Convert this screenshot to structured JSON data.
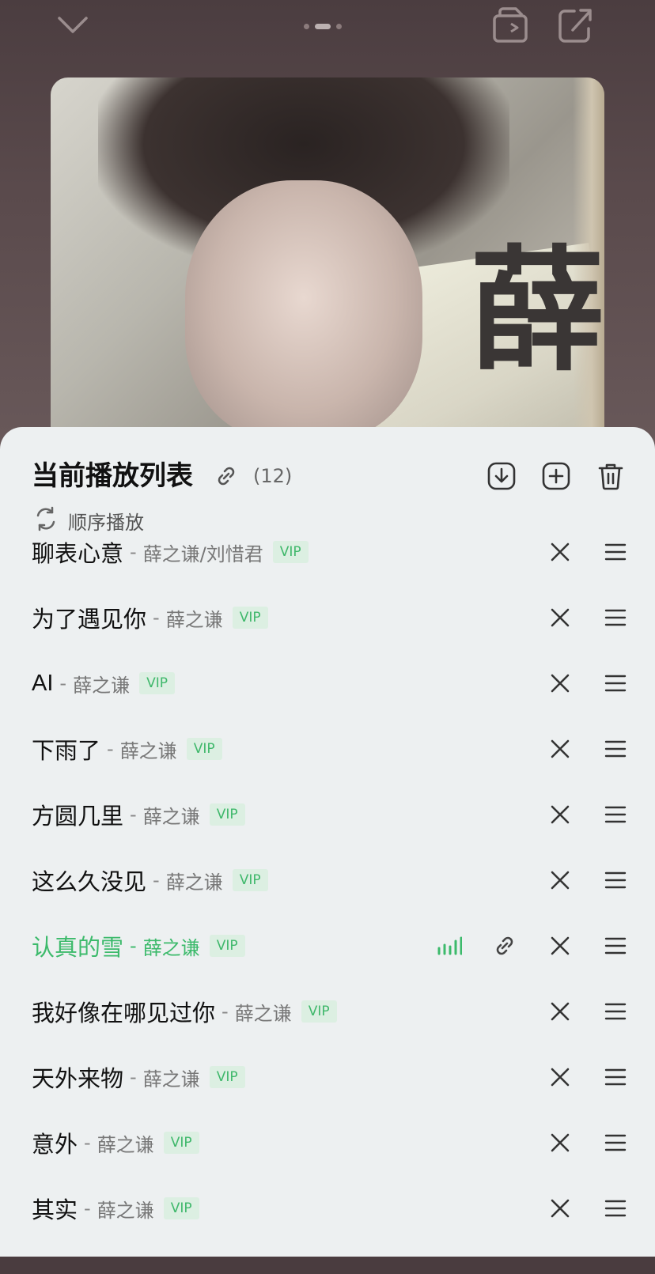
{
  "top_bar": {
    "collapse_icon": "chevron-down-icon",
    "page_indicator": {
      "count": 3,
      "active": 1
    },
    "icons": [
      "screen-rotate-icon",
      "share-icon"
    ]
  },
  "album": {
    "overlay_text": "薛"
  },
  "playlist": {
    "title": "当前播放列表",
    "count": "(12)",
    "mode_label": "顺序播放",
    "actions": [
      "download-icon",
      "add-icon",
      "trash-icon"
    ],
    "accent_color": "#3cba6b",
    "songs": [
      {
        "title": "聊表心意",
        "sep": "-",
        "artist": "薛之谦/刘惜君",
        "badge": "VIP"
      },
      {
        "title": "为了遇见你",
        "sep": "-",
        "artist": "薛之谦",
        "badge": "VIP"
      },
      {
        "title": "AI",
        "sep": "-",
        "artist": "薛之谦",
        "badge": "VIP"
      },
      {
        "title": "下雨了",
        "sep": "-",
        "artist": "薛之谦",
        "badge": "VIP"
      },
      {
        "title": "方圆几里",
        "sep": "-",
        "artist": "薛之谦",
        "badge": "VIP"
      },
      {
        "title": "这么久没见",
        "sep": "-",
        "artist": "薛之谦",
        "badge": "VIP"
      },
      {
        "title": "认真的雪",
        "sep": "-",
        "artist": "薛之谦",
        "badge": "VIP",
        "playing": true
      },
      {
        "title": "我好像在哪见过你",
        "sep": "-",
        "artist": "薛之谦",
        "badge": "VIP"
      },
      {
        "title": "天外来物",
        "sep": "-",
        "artist": "薛之谦",
        "badge": "VIP"
      },
      {
        "title": "意外",
        "sep": "-",
        "artist": "薛之谦",
        "badge": "VIP"
      },
      {
        "title": "其实",
        "sep": "-",
        "artist": "薛之谦",
        "badge": "VIP"
      }
    ]
  }
}
